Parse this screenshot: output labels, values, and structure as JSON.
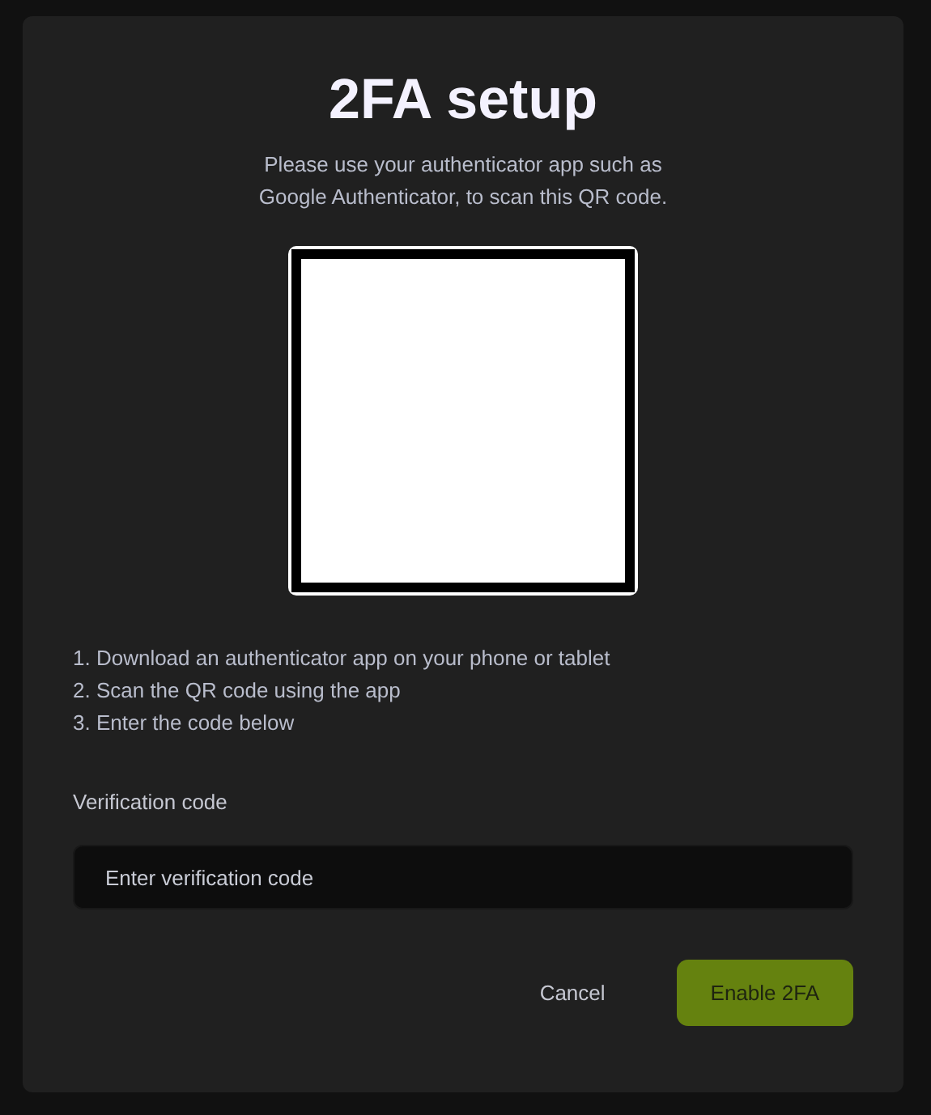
{
  "dialog": {
    "title": "2FA setup",
    "subtitle_lines": [
      "Please use your authenticator app such as",
      "Google Authenticator, to scan this QR code."
    ],
    "qr_code": {
      "kind": "blank"
    },
    "steps": [
      "1. Download an authenticator app on your phone or tablet",
      "2. Scan the QR code using the app",
      "3. Enter the code below"
    ],
    "field": {
      "label": "Verification code",
      "placeholder": "Enter verification code"
    },
    "buttons": [
      {
        "label": "Cancel",
        "kind": "text"
      },
      {
        "label": "Enable 2FA",
        "kind": "primary"
      }
    ]
  }
}
